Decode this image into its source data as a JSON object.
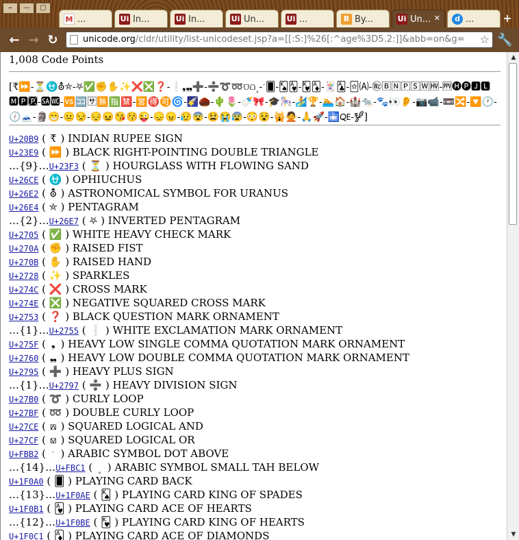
{
  "window": {
    "buttons": [
      "⎯",
      "—",
      "▢"
    ]
  },
  "tabs": [
    {
      "label": "...",
      "icon": "gmail-icon",
      "fav": "M",
      "cls": "gmail"
    },
    {
      "label": "In...",
      "icon": "unicode-icon",
      "fav": "Ui",
      "cls": "uni"
    },
    {
      "label": "In...",
      "icon": "unicode-icon",
      "fav": "Ui",
      "cls": "uni"
    },
    {
      "label": "Un...",
      "icon": "unicode-icon",
      "fav": "Ui",
      "cls": "uni"
    },
    {
      "label": "...",
      "icon": "unicode-icon",
      "fav": "Ui",
      "cls": "uni"
    },
    {
      "label": "By...",
      "icon": "blogger-icon",
      "fav": "B",
      "cls": "by"
    },
    {
      "label": "Un...",
      "icon": "unicode-icon",
      "fav": "Ui",
      "cls": "uni",
      "active": true
    },
    {
      "label": "...",
      "icon": "drupal-icon",
      "fav": "d",
      "cls": "drupal"
    }
  ],
  "toolbar": {
    "back": "←",
    "forward": "→",
    "reload": "↻",
    "url_host": "unicode.org",
    "url_rest": "/cldr/utility/list-unicodeset.jsp?a=[[:S:]%26[:^age%3D5.2:]]&abb=on&g=",
    "star": "☆",
    "wrench": "🔧",
    "newtab": "+"
  },
  "page": {
    "count": "1,008 Code Points",
    "set_preview": "[₹⏩-⏳⛎⛢⛤-⛧✅✊✋✨❌❎❓-❕❟❠➕-➗➰➿⩌⩍﮲-﯁🂠-🂮🂱-🂾🃁-🃏🃑-🃟🄐-🄮🄱🄽🄿🅂🅆🅊-🅎🅗🅟🅹🅻🅼🅿🆊-🆍🆏-🆚🈁🈂🈚🈯🈲-🈺🉐🉑🌀-🌠🌰-🌵🌷-🍼🎀-🎓🎠-🏄🏆-🏊🏠-🏰🐀-🐾👀👂-📷📹-📼🔀-🔽🕐-🕧🗻-🗿😁-😐😒-😔😖😘😚😜-😞😠-😥😨-😫😭😰-😳😵-🙀🙅-🙏🚀-🛅🜀-🝳]",
    "rows": [
      {
        "prefix": "",
        "code": "U+20B9",
        "glyph": "₹",
        "name": "INDIAN RUPEE SIGN"
      },
      {
        "prefix": "",
        "code": "U+23E9",
        "glyph": "⏩",
        "name": "BLACK RIGHT-POINTING DOUBLE TRIANGLE"
      },
      {
        "prefix": "…{9}…",
        "code": "U+23F3",
        "glyph": "⏳",
        "name": "HOURGLASS WITH FLOWING SAND"
      },
      {
        "prefix": "",
        "code": "U+26CE",
        "glyph": "⛎",
        "name": "OPHIUCHUS"
      },
      {
        "prefix": "",
        "code": "U+26E2",
        "glyph": "⛢",
        "name": "ASTRONOMICAL SYMBOL FOR URANUS"
      },
      {
        "prefix": "",
        "code": "U+26E4",
        "glyph": "⛤",
        "name": "PENTAGRAM"
      },
      {
        "prefix": "…{2}…",
        "code": "U+26E7",
        "glyph": "⛧",
        "name": "INVERTED PENTAGRAM"
      },
      {
        "prefix": "",
        "code": "U+2705",
        "glyph": "✅",
        "name": "WHITE HEAVY CHECK MARK"
      },
      {
        "prefix": "",
        "code": "U+270A",
        "glyph": "✊",
        "name": "RAISED FIST"
      },
      {
        "prefix": "",
        "code": "U+270B",
        "glyph": "✋",
        "name": "RAISED HAND"
      },
      {
        "prefix": "",
        "code": "U+2728",
        "glyph": "✨",
        "name": "SPARKLES"
      },
      {
        "prefix": "",
        "code": "U+274C",
        "glyph": "❌",
        "name": "CROSS MARK"
      },
      {
        "prefix": "",
        "code": "U+274E",
        "glyph": "❎",
        "name": "NEGATIVE SQUARED CROSS MARK"
      },
      {
        "prefix": "",
        "code": "U+2753",
        "glyph": "❓",
        "name": "BLACK QUESTION MARK ORNAMENT"
      },
      {
        "prefix": "…{1}…",
        "code": "U+2755",
        "glyph": "❕",
        "name": "WHITE EXCLAMATION MARK ORNAMENT"
      },
      {
        "prefix": "",
        "code": "U+275F",
        "glyph": "❟",
        "name": "HEAVY LOW SINGLE COMMA QUOTATION MARK ORNAMENT"
      },
      {
        "prefix": "",
        "code": "U+2760",
        "glyph": "❠",
        "name": "HEAVY LOW DOUBLE COMMA QUOTATION MARK ORNAMENT"
      },
      {
        "prefix": "",
        "code": "U+2795",
        "glyph": "➕",
        "name": "HEAVY PLUS SIGN"
      },
      {
        "prefix": "…{1}…",
        "code": "U+2797",
        "glyph": "➗",
        "name": "HEAVY DIVISION SIGN"
      },
      {
        "prefix": "",
        "code": "U+27B0",
        "glyph": "➰",
        "name": "CURLY LOOP"
      },
      {
        "prefix": "",
        "code": "U+27BF",
        "glyph": "➿",
        "name": "DOUBLE CURLY LOOP"
      },
      {
        "prefix": "",
        "code": "U+27CE",
        "glyph": "⟎",
        "name": "SQUARED LOGICAL AND"
      },
      {
        "prefix": "",
        "code": "U+27CF",
        "glyph": "⟏",
        "name": "SQUARED LOGICAL OR"
      },
      {
        "prefix": "",
        "code": "U+FBB2",
        "glyph": "﮲",
        "name": "ARABIC SYMBOL DOT ABOVE"
      },
      {
        "prefix": "…{14}…",
        "code": "U+FBC1",
        "glyph": "﯁",
        "name": "ARABIC SYMBOL SMALL TAH BELOW"
      },
      {
        "prefix": "",
        "code": "U+1F0A0",
        "glyph": "🂠",
        "name": "PLAYING CARD BACK"
      },
      {
        "prefix": "…{13}…",
        "code": "U+1F0AE",
        "glyph": "🂮",
        "name": "PLAYING CARD KING OF SPADES"
      },
      {
        "prefix": "",
        "code": "U+1F0B1",
        "glyph": "🂱",
        "name": "PLAYING CARD ACE OF HEARTS"
      },
      {
        "prefix": "…{12}…",
        "code": "U+1F0BE",
        "glyph": "🂾",
        "name": "PLAYING CARD KING OF HEARTS"
      },
      {
        "prefix": "",
        "code": "U+1F0C1",
        "glyph": "🃁",
        "name": "PLAYING CARD ACE OF DIAMONDS"
      }
    ]
  }
}
